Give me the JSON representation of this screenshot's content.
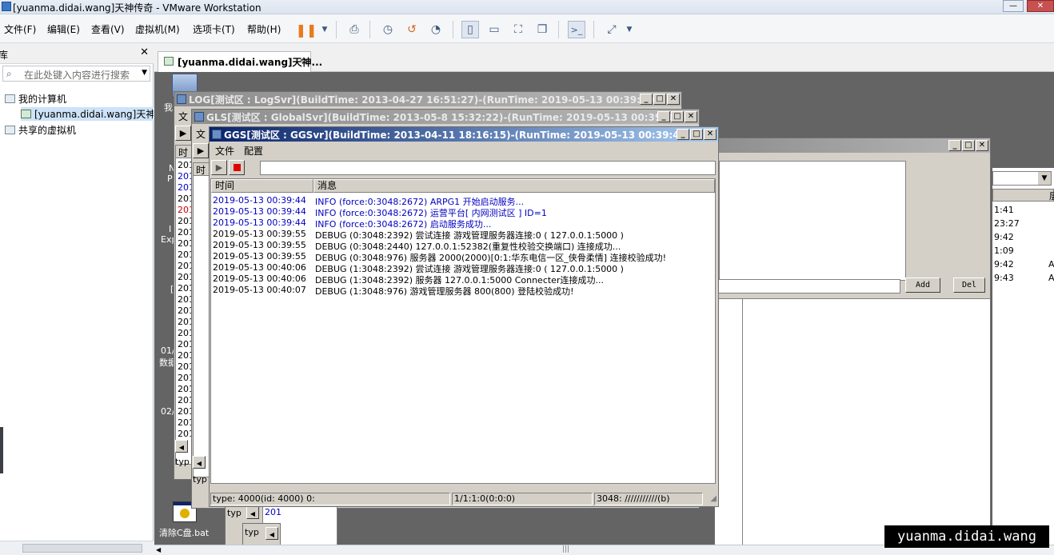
{
  "window": {
    "title": "[yuanma.didai.wang]天神传奇 - VMware Workstation"
  },
  "menu": [
    "文件(F)",
    "编辑(E)",
    "查看(V)",
    "虚拟机(M)",
    "选项卡(T)",
    "帮助(H)"
  ],
  "toolbar": {
    "icons": [
      "pause-icon",
      "dropdown-icon",
      "send-ctrl-alt-del-icon",
      "snapshot-icon",
      "revert-snapshot-icon",
      "snapshot-manager-icon",
      "library-view-icon",
      "thumbnail-view-icon",
      "fullscreen-icon",
      "unity-icon",
      "console-icon",
      "stretch-icon"
    ]
  },
  "library": {
    "title": "库",
    "close": "✕",
    "search_placeholder": "在此处键入内容进行搜索",
    "items": [
      {
        "label": "我的计算机",
        "icon": "computer-icon"
      },
      {
        "label": "[yuanma.didai.wang]天神",
        "icon": "vm-icon"
      },
      {
        "label": "共享的虚拟机",
        "icon": "shared-vm-icon"
      }
    ]
  },
  "tab": {
    "label": "[yuanma.didai.wang]天神...",
    "close": "✕"
  },
  "desktop": {
    "icon_label_1": "我",
    "bat_label": "清除C盘.bat",
    "partial_labels": [
      "N",
      "P",
      "I",
      "Exp",
      "[",
      "01/",
      "数据",
      "02/"
    ]
  },
  "log_window": {
    "title": "LOG[测试区 : LogSvr](BuildTime: 2013-04-27 16:51:27)-(RunTime: 2019-05-13 00:39:29)",
    "menu_partial": "文",
    "header_partial": "时",
    "rows_partial": [
      "201",
      "201",
      "201",
      "201",
      "201",
      "201",
      "201",
      "201",
      "201",
      "201",
      "201",
      "201",
      "201",
      "201",
      "201",
      "201",
      "201",
      "201",
      "201",
      "201",
      "201",
      "201",
      "201",
      "201",
      "201"
    ],
    "type_partial": "typ"
  },
  "gls_window": {
    "title": "GLS[测试区 : GlobalSvr](BuildTime: 2013-05-8 15:32:22)-(RunTime: 2019-05-13 00:39:36)",
    "menu_partial": "文",
    "header_partial": "时",
    "type_partial": "typ"
  },
  "back_window": {
    "add_button": "Add",
    "del_button": "Del",
    "times": [
      "1:41",
      "23:27",
      "9:42",
      "1:09",
      "9:42",
      "9:43"
    ],
    "col_right": [
      "A",
      "A"
    ],
    "header_partial": "层"
  },
  "ggs_window": {
    "title": "GGS[测试区 : GGSvr](BuildTime: 2013-04-11 18:16:15)-(RunTime: 2019-05-13 00:39:44)",
    "menu": [
      "文件",
      "配置"
    ],
    "columns": [
      "时间",
      "消息"
    ],
    "rows": [
      {
        "time": "2019-05-13 00:39:44",
        "msg": "INFO (force:0:3048:2672) ARPG1 开始启动服务...",
        "color": "#0000c0"
      },
      {
        "time": "2019-05-13 00:39:44",
        "msg": "INFO (force:0:3048:2672) 运营平台[ 内网测试区 ] ID=1",
        "color": "#0000c0"
      },
      {
        "time": "2019-05-13 00:39:44",
        "msg": "INFO (force:0:3048:2672) 启动服务成功...",
        "color": "#0000c0"
      },
      {
        "time": "2019-05-13 00:39:55",
        "msg": "DEBUG (0:3048:2392) 尝试连接 游戏管理服务器连接:0 ( 127.0.0.1:5000 )",
        "color": "#000000"
      },
      {
        "time": "2019-05-13 00:39:55",
        "msg": "DEBUG (0:3048:2440) 127.0.0.1:52382(重复性校验交换端口) 连接成功...",
        "color": "#000000"
      },
      {
        "time": "2019-05-13 00:39:55",
        "msg": "DEBUG (0:3048:976) 服务器 2000(2000)[0:1:华东电信一区_侠骨柔情] 连接校验成功!",
        "color": "#000000"
      },
      {
        "time": "2019-05-13 00:40:06",
        "msg": "DEBUG (1:3048:2392) 尝试连接 游戏管理服务器连接:0 ( 127.0.0.1:5000 )",
        "color": "#000000"
      },
      {
        "time": "2019-05-13 00:40:06",
        "msg": "DEBUG (1:3048:2392) 服务器 127.0.0.1:5000 Connecter连接成功...",
        "color": "#000000"
      },
      {
        "time": "2019-05-13 00:40:07",
        "msg": "DEBUG (1:3048:976) 游戏管理服务器 800(800) 登陆校验成功!",
        "color": "#000000"
      }
    ],
    "status": [
      "type: 4000(id: 4000) 0:",
      "1/1:1:0(0:0:0)",
      "3048: ///////////(b)"
    ]
  },
  "watermark": "yuanma.didai.wang",
  "colors": {
    "active_title": "#0a246a",
    "inactive_title": "#8e8e8e",
    "info_text": "#0000c0",
    "desktop": "#646464"
  }
}
